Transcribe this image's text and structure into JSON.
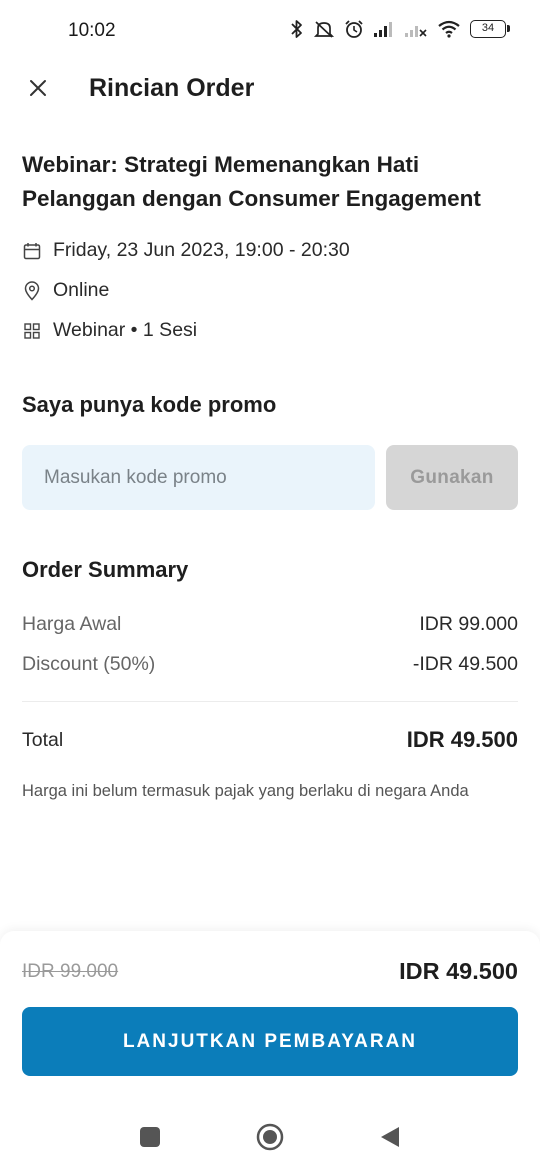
{
  "status_bar": {
    "time": "10:02",
    "battery": "34",
    "icons": [
      "bluetooth-icon",
      "mute-icon",
      "alarm-icon",
      "signal-icon",
      "signal-off-icon",
      "wifi-icon",
      "battery-icon"
    ]
  },
  "header": {
    "title": "Rincian Order",
    "close_icon": "close-icon"
  },
  "event": {
    "title": "Webinar: Strategi Memenangkan Hati Pelanggan dengan Consumer Engagement",
    "date": "Friday, 23 Jun 2023, 19:00 - 20:30",
    "location": "Online",
    "type": "Webinar • 1 Sesi",
    "icons": [
      "calendar-icon",
      "location-pin-icon",
      "grid-icon"
    ]
  },
  "promo": {
    "title": "Saya punya kode promo",
    "input_placeholder": "Masukan kode promo",
    "input_value": "",
    "button_label": "Gunakan"
  },
  "summary": {
    "title": "Order Summary",
    "rows": [
      {
        "label": "Harga Awal",
        "value": "IDR 99.000"
      },
      {
        "label": "Discount (50%)",
        "value": "-IDR 49.500"
      }
    ],
    "total_label": "Total",
    "total_value": "IDR 49.500",
    "tax_note": "Harga ini belum termasuk pajak yang berlaku di negara Anda"
  },
  "checkout": {
    "old_price": "IDR 99.000",
    "new_price": "IDR 49.500",
    "pay_button_label": "LANJUTKAN PEMBAYARAN"
  },
  "nav_bar": {
    "buttons": [
      "recents-icon",
      "home-icon",
      "back-icon"
    ]
  },
  "colors": {
    "accent": "#0b7dba",
    "input_bg": "#eaf4fb",
    "disabled_button": "#d6d6d6"
  }
}
